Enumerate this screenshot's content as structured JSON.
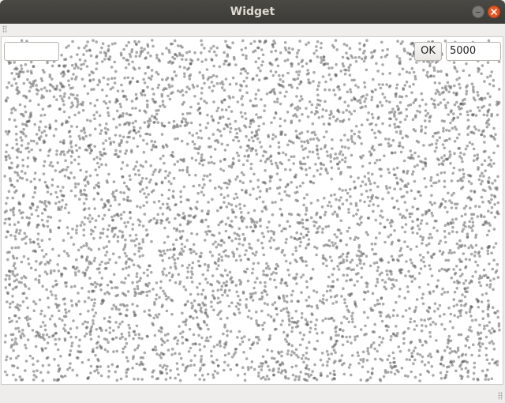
{
  "window": {
    "title": "Widget",
    "buttons": {
      "minimize": "minimize-icon",
      "close": "close-icon"
    },
    "accent_color": "#e95420"
  },
  "controls": {
    "left_input_value": "",
    "ok_label": "OK",
    "point_count_value": "5000"
  },
  "chart_data": {
    "type": "scatter",
    "title": "",
    "xlabel": "",
    "ylabel": "",
    "point_count": 5000,
    "distribution": "uniform-random",
    "xlim": [
      0,
      1
    ],
    "ylim": [
      0,
      1
    ],
    "point_color": "#555555",
    "point_opacity": 0.5,
    "grid": false,
    "legend": "none"
  }
}
